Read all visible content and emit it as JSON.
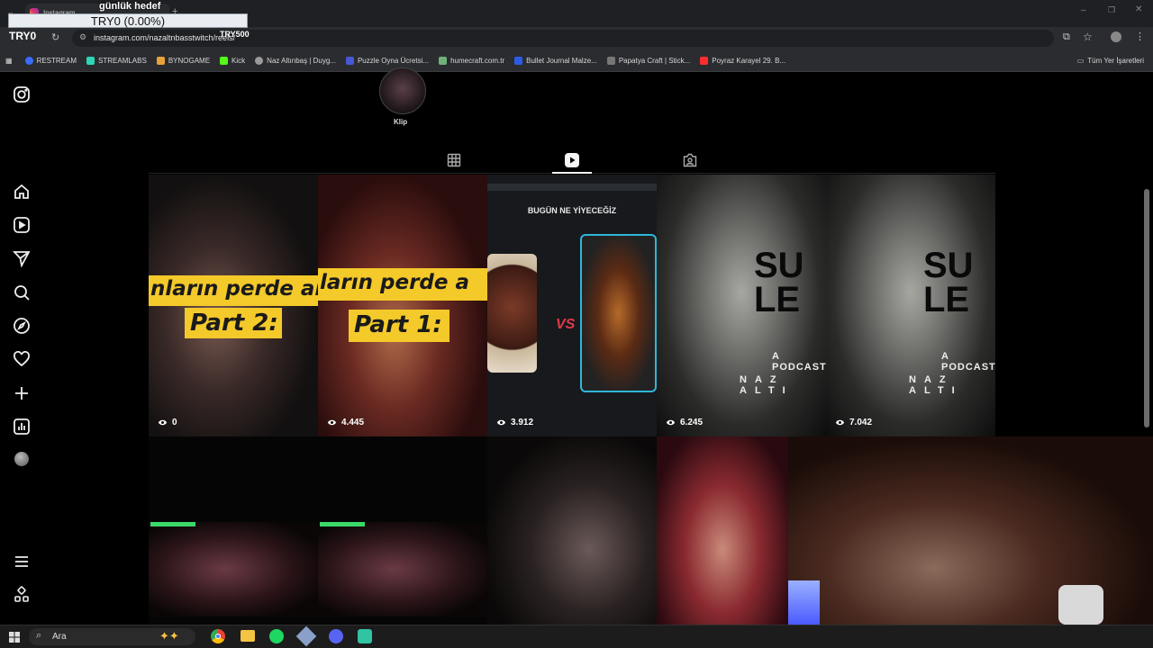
{
  "browser": {
    "tab_title": "Instagram",
    "url": "instagram.com/nazaltnbasstwitch/reels/",
    "bookmarks": [
      {
        "label": "RESTREAM",
        "color": "#3b6cff"
      },
      {
        "label": "STREAMLABS",
        "color": "#2fd6b5"
      },
      {
        "label": "BYNOGAME",
        "color": "#e6a23c"
      },
      {
        "label": "Kick",
        "color": "#53fc18"
      },
      {
        "label": "Naz Altınbaş | Duyg...",
        "color": "#9a9a9a"
      },
      {
        "label": "Puzzle Oyna Ücretsi...",
        "color": "#4757d6"
      },
      {
        "label": "humecraft.com.tr",
        "color": "#6fb07a"
      },
      {
        "label": "Bullet Journal Malze...",
        "color": "#2b5ce6"
      },
      {
        "label": "Papatya Craft | Stick...",
        "color": "#777777"
      },
      {
        "label": "Poyraz Karayel 29. B...",
        "color": "#ff2d2d"
      }
    ],
    "all_bookmarks_label": "Tüm Yer İşaretleri"
  },
  "stream_overlay": {
    "goal_title": "günlük hedef",
    "goal_value": "TRY0 (0.00%)",
    "left_amount": "TRY0",
    "right_amount": "TRY500"
  },
  "profile": {
    "highlight_label": "Klip"
  },
  "tabs": [
    {
      "name": "posts",
      "icon": "grid-icon",
      "active": false
    },
    {
      "name": "reels",
      "icon": "reels-icon",
      "active": true
    },
    {
      "name": "tagged",
      "icon": "tagged-icon",
      "active": false
    }
  ],
  "reels": [
    {
      "views": "0",
      "caption_top": "nların perde ar",
      "caption_bottom": "Part 2:"
    },
    {
      "views": "4.445",
      "caption_top": "ların perde a",
      "caption_bottom": "Part 1:"
    },
    {
      "views": "3.912",
      "header": "BUGÜN NE YİYECEĞİZ"
    },
    {
      "views": "6.245",
      "big_text": "SU\nLE",
      "sub_text": "A PODCAST",
      "name_text": "NAZ ALTI"
    },
    {
      "views": "7.042",
      "big_text": "SU\nLE",
      "sub_text": "A PODCAST",
      "name_text": "NAZ ALTI"
    }
  ],
  "nav_icons": [
    "instagram-logo-icon",
    "home-icon",
    "reels-nav-icon",
    "messages-icon",
    "search-icon",
    "explore-icon",
    "notifications-icon",
    "create-icon",
    "dashboard-icon",
    "profile-avatar-icon",
    "menu-icon",
    "more-apps-icon"
  ],
  "taskbar": {
    "search_placeholder": "Ara",
    "apps": [
      "copilot-icon",
      "chrome-icon",
      "file-explorer-icon",
      "spotify-icon",
      "app-icon",
      "discord-icon",
      "streamlabs-icon"
    ]
  }
}
